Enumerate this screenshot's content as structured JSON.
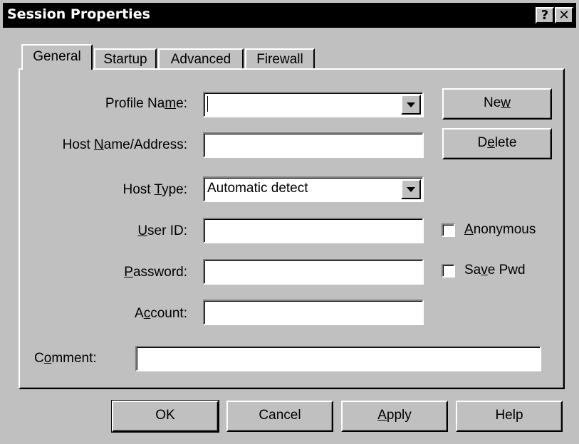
{
  "window": {
    "title": "Session Properties",
    "help_button": "?",
    "close_button": "✕"
  },
  "tabs": [
    {
      "label": "General",
      "active": true
    },
    {
      "label": "Startup",
      "active": false
    },
    {
      "label": "Advanced",
      "active": false
    },
    {
      "label": "Firewall",
      "active": false
    }
  ],
  "form": {
    "profile_name": {
      "label_pre": "Profile Na",
      "label_u": "m",
      "label_post": "e:",
      "value": ""
    },
    "host_name": {
      "label_pre": "Host ",
      "label_u": "N",
      "label_post": "ame/Address:",
      "value": ""
    },
    "host_type": {
      "label_pre": "Host ",
      "label_u": "T",
      "label_post": "ype:",
      "value": "Automatic detect"
    },
    "user_id": {
      "label_pre": "",
      "label_u": "U",
      "label_post": "ser ID:",
      "value": ""
    },
    "password": {
      "label_pre": "",
      "label_u": "P",
      "label_post": "assword:",
      "value": ""
    },
    "account": {
      "label_pre": "A",
      "label_u": "c",
      "label_post": "count:",
      "value": ""
    },
    "comment": {
      "label_pre": "C",
      "label_u": "o",
      "label_post": "mment:",
      "value": ""
    }
  },
  "side_buttons": {
    "new": {
      "pre": "Ne",
      "u": "w",
      "post": ""
    },
    "delete": {
      "pre": "D",
      "u": "e",
      "post": "lete"
    }
  },
  "checkboxes": {
    "anonymous": {
      "pre": "",
      "u": "A",
      "post": "nonymous",
      "checked": false
    },
    "save_pwd": {
      "pre": "Sa",
      "u": "v",
      "post": "e Pwd",
      "checked": false
    }
  },
  "footer_buttons": {
    "ok": {
      "pre": "OK",
      "u": "",
      "post": ""
    },
    "cancel": {
      "pre": "Cancel",
      "u": "",
      "post": ""
    },
    "apply": {
      "pre": "",
      "u": "A",
      "post": "pply"
    },
    "help": {
      "pre": "Help",
      "u": "",
      "post": ""
    }
  }
}
